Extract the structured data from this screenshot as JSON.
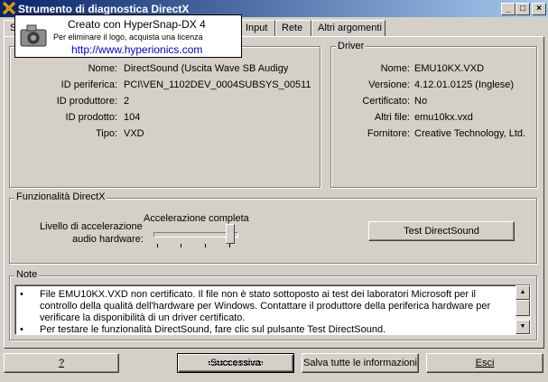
{
  "window": {
    "title": "Strumento di diagnostica DirectX",
    "buttons": {
      "minimize": "_",
      "maximize": "□",
      "close": "×"
    }
  },
  "tabs": [
    {
      "label": "S"
    },
    {
      "label": "Input"
    },
    {
      "label": "Rete"
    },
    {
      "label": "Altri argomenti"
    }
  ],
  "watermark": {
    "line1": "Creato con HyperSnap-DX 4",
    "line2": "Per eliminare il logo, acquista una licenza",
    "line3": "http://www.hyperionics.com"
  },
  "device": {
    "rows": [
      {
        "label": "Nome:",
        "value": "DirectSound (Uscita Wave SB Audigy"
      },
      {
        "label": "ID periferica:",
        "value": "PCI\\VEN_1102DEV_0004SUBSYS_00511"
      },
      {
        "label": "ID produttore:",
        "value": "2"
      },
      {
        "label": "ID prodotto:",
        "value": "104"
      },
      {
        "label": "Tipo:",
        "value": "VXD"
      }
    ]
  },
  "driver": {
    "title": "Driver",
    "rows": [
      {
        "label": "Nome:",
        "value": "EMU10KX.VXD"
      },
      {
        "label": "Versione:",
        "value": "4.12.01.0125 (Inglese)"
      },
      {
        "label": "Certificato:",
        "value": "No"
      },
      {
        "label": "Altri file:",
        "value": "emu10kx.vxd"
      },
      {
        "label": "Fornitore:",
        "value": "Creative Technology, Ltd."
      }
    ]
  },
  "features": {
    "title": "Funzionalità DirectX",
    "accel_label_1": "Livello di accelerazione",
    "accel_label_2": "audio hardware:",
    "accel_value": "Accelerazione completa",
    "slider_level": 1.0,
    "test_button": "Test DirectSound"
  },
  "notes": {
    "title": "Note",
    "items": [
      "File EMU10KX.VXD non certificato. Il file non è stato sottoposto ai test dei laboratori Microsoft per il controllo della qualità dell'hardware per Windows. Contattare il produttore della periferica hardware per verificare la disponibilità di un driver certificato.",
      "Per testare le funzionalità DirectSound, fare clic sul pulsante Test DirectSound."
    ],
    "bullet": "•"
  },
  "footer": {
    "help": "?",
    "next": "Successiva",
    "save": "Salva tutte le informazioni",
    "exit": "Esci"
  }
}
